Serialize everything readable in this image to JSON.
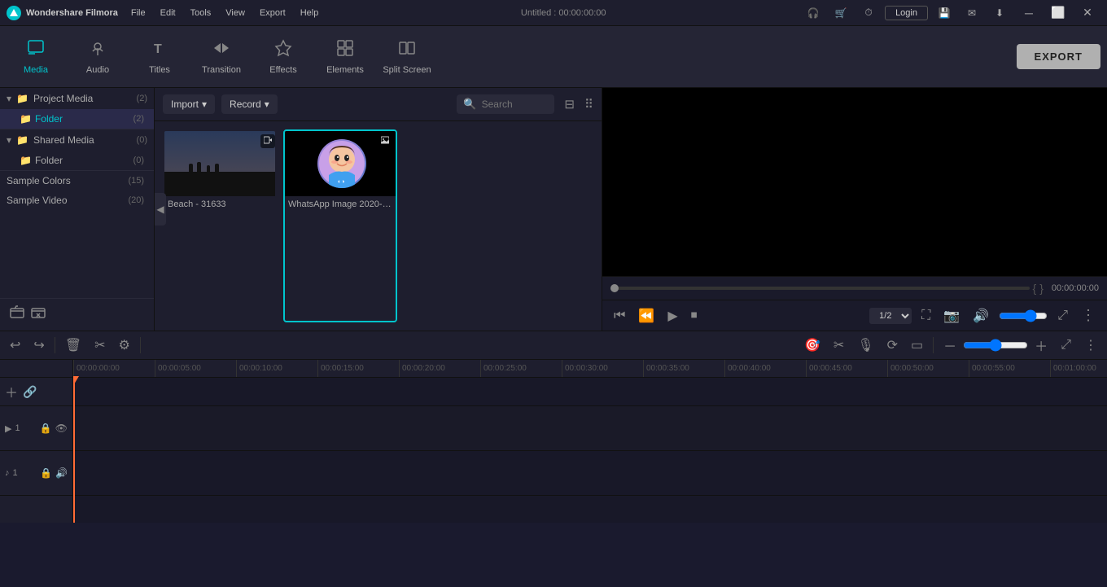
{
  "app": {
    "name": "Wondershare Filmora",
    "title": "Untitled : 00:00:00:00"
  },
  "titlebar": {
    "menu_items": [
      "File",
      "Edit",
      "Tools",
      "View",
      "Export",
      "Help"
    ],
    "right_icons": [
      "headphone",
      "cart",
      "clock",
      "login",
      "save",
      "mail",
      "download"
    ],
    "login_label": "Login",
    "controls": [
      "minimize",
      "maximize",
      "close"
    ]
  },
  "toolbar": {
    "tools": [
      {
        "id": "media",
        "label": "Media",
        "icon": "▣",
        "active": true
      },
      {
        "id": "audio",
        "label": "Audio",
        "icon": "♪"
      },
      {
        "id": "titles",
        "label": "Titles",
        "icon": "T"
      },
      {
        "id": "transition",
        "label": "Transition",
        "icon": "⇄"
      },
      {
        "id": "effects",
        "label": "Effects",
        "icon": "✦"
      },
      {
        "id": "elements",
        "label": "Elements",
        "icon": "◈"
      },
      {
        "id": "splitscreen",
        "label": "Split Screen",
        "icon": "⊞"
      }
    ],
    "export_label": "EXPORT"
  },
  "sidebar": {
    "groups": [
      {
        "id": "project-media",
        "label": "Project Media",
        "count": 2,
        "expanded": true,
        "children": [
          {
            "id": "folder",
            "label": "Folder",
            "count": 2,
            "active": true
          }
        ]
      },
      {
        "id": "shared-media",
        "label": "Shared Media",
        "count": 0,
        "expanded": true,
        "children": [
          {
            "id": "shared-folder",
            "label": "Folder",
            "count": 0
          }
        ]
      },
      {
        "id": "sample-colors",
        "label": "Sample Colors",
        "count": 15,
        "expanded": false,
        "children": []
      },
      {
        "id": "sample-video",
        "label": "Sample Video",
        "count": 20,
        "expanded": false,
        "children": []
      }
    ]
  },
  "media_panel": {
    "import_label": "Import",
    "record_label": "Record",
    "search_placeholder": "Search",
    "items": [
      {
        "id": "beach",
        "label": "Beach - 31633",
        "type": "video"
      },
      {
        "id": "whatsapp",
        "label": "WhatsApp Image 2020-1...",
        "type": "image"
      }
    ]
  },
  "preview": {
    "time_display": "00:00:00:00",
    "progress_ratio": "1/2",
    "bracket_open": "{",
    "bracket_close": "}"
  },
  "timeline": {
    "tracks": [
      {
        "id": "video1",
        "label": "▶1",
        "type": "video"
      },
      {
        "id": "audio1",
        "label": "♪1",
        "type": "audio"
      }
    ],
    "ruler_marks": [
      "00:00:00:00",
      "00:00:05:00",
      "00:00:10:00",
      "00:00:15:00",
      "00:00:20:00",
      "00:00:25:00",
      "00:00:30:00",
      "00:00:35:00",
      "00:00:40:00",
      "00:00:45:00",
      "00:00:50:00",
      "00:00:55:00",
      "00:01:00:00"
    ]
  },
  "icons": {
    "chevron_down": "▾",
    "chevron_right": "▸",
    "folder": "📁",
    "search": "🔍",
    "filter": "⊟",
    "grid": "⠿",
    "undo": "↩",
    "redo": "↪",
    "delete": "🗑",
    "cut": "✂",
    "settings": "≡",
    "snapshot": "📷",
    "voice": "🎙",
    "motion": "⟳",
    "captions": "▭",
    "zoom_out": "－",
    "zoom_in": "＋",
    "full": "⤢",
    "lock": "🔒",
    "eye": "👁",
    "audio_icon": "🔊",
    "add_media": "＋",
    "link": "🔗",
    "play": "▶",
    "pause": "⏸",
    "step_back": "⏮",
    "step_forward": "⏭",
    "stop": "⏹",
    "volume": "🔊",
    "screen": "⛶",
    "camera": "📷"
  }
}
